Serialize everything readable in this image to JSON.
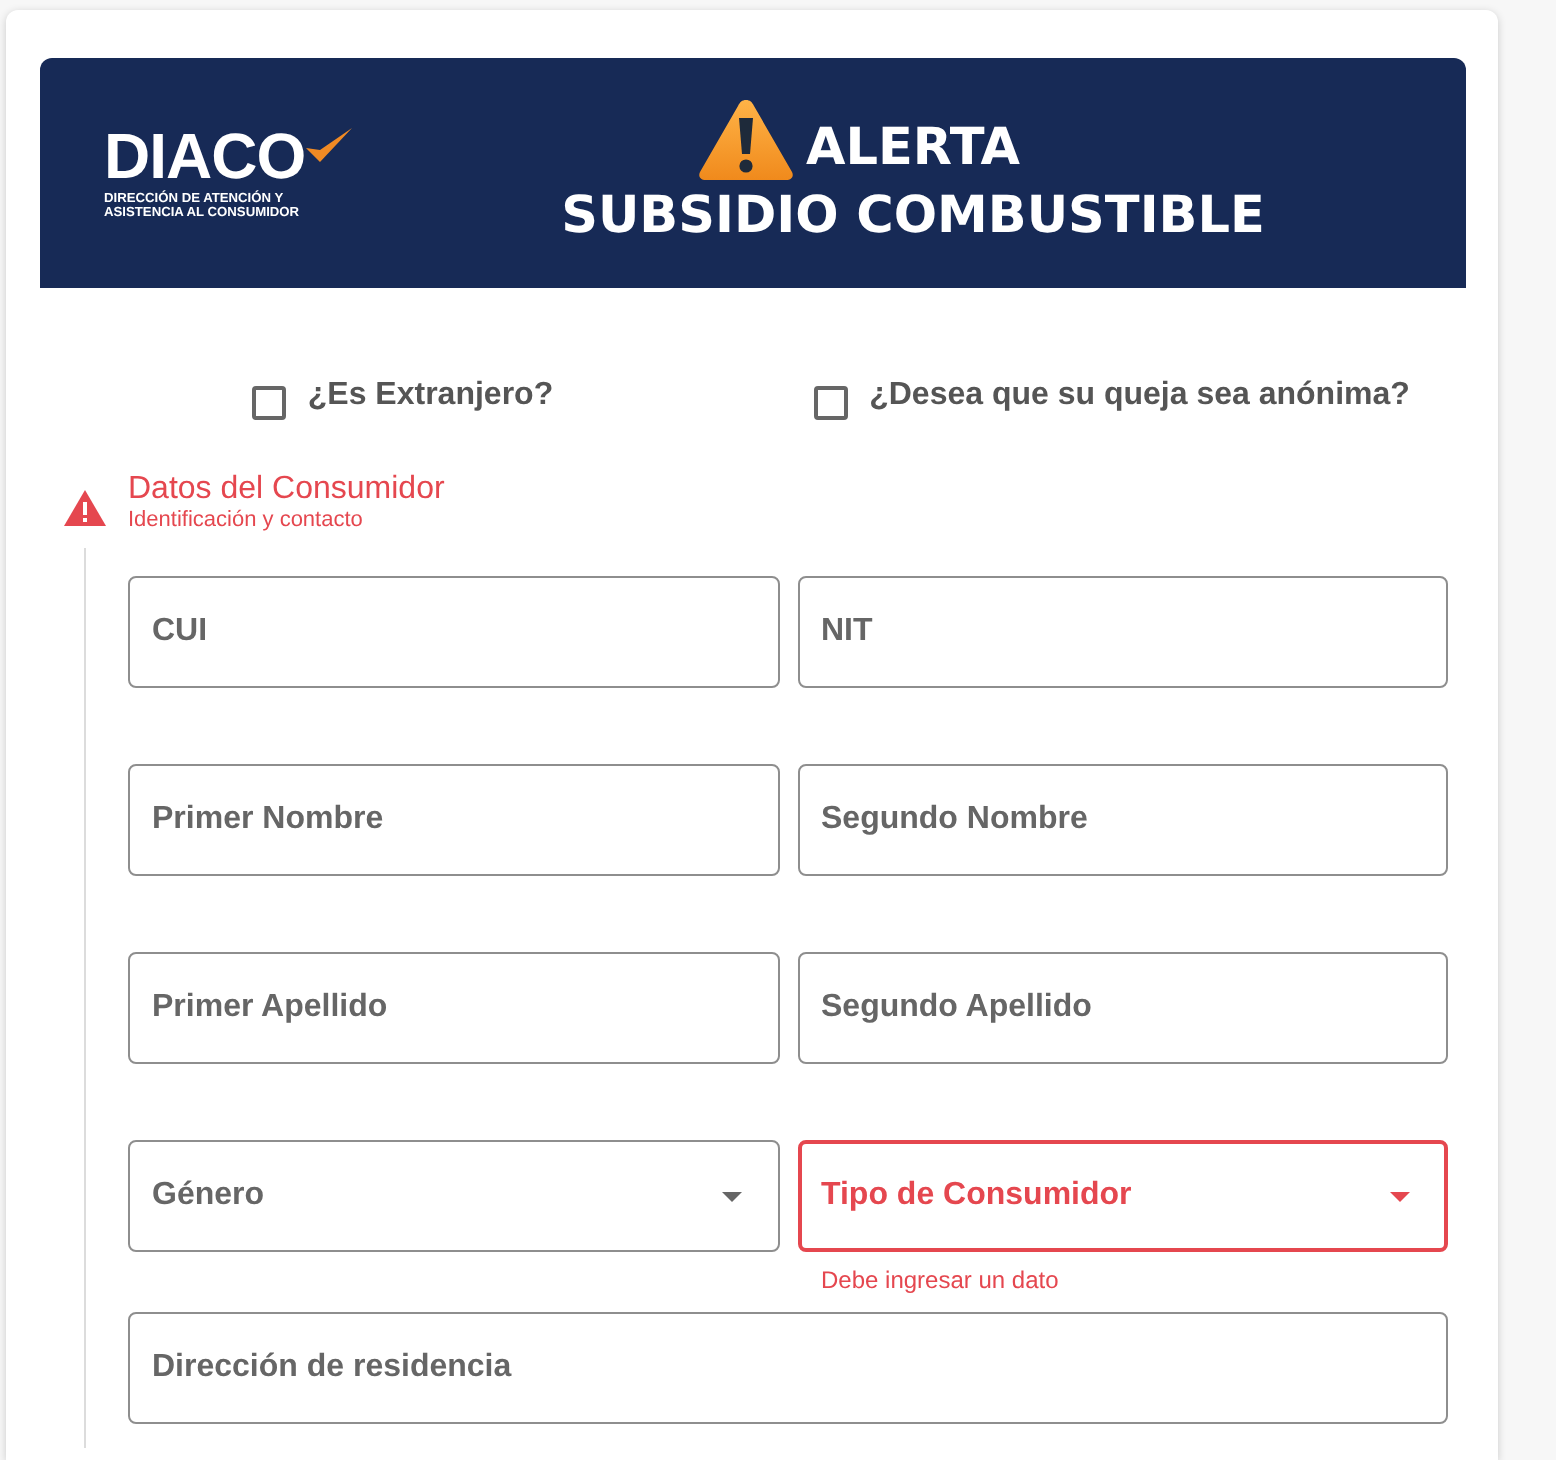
{
  "banner": {
    "logo": {
      "wordmark": "DIACO",
      "tagline_lines": [
        "DIRECCIÓN DE ATENCIÓN Y",
        "ASISTENCIA AL CONSUMIDOR"
      ]
    },
    "title": {
      "alert": "ALERTA",
      "subject": "SUBSIDIO COMBUSTIBLE"
    }
  },
  "options": [
    {
      "label": "¿Es Extranjero?",
      "checked": false
    },
    {
      "label": "¿Desea que su queja sea anónima?",
      "checked": false
    }
  ],
  "section": {
    "title": "Datos del Consumidor",
    "subtitle": "Identificación y contacto",
    "error": true
  },
  "field_rows": [
    [
      {
        "label": "CUI",
        "kind": "text",
        "error": false
      },
      {
        "label": "NIT",
        "kind": "text",
        "error": false
      }
    ],
    [
      {
        "label": "Primer Nombre",
        "kind": "text",
        "error": false
      },
      {
        "label": "Segundo Nombre",
        "kind": "text",
        "error": false
      }
    ],
    [
      {
        "label": "Primer Apellido",
        "kind": "text",
        "error": false
      },
      {
        "label": "Segundo Apellido",
        "kind": "text",
        "error": false
      }
    ],
    [
      {
        "label": "Género",
        "kind": "select",
        "error": false
      },
      {
        "label": "Tipo de Consumidor",
        "kind": "select",
        "error": true,
        "error_text": "Debe ingresar un dato"
      }
    ],
    [
      {
        "label": "Dirección de residencia",
        "kind": "text",
        "error": false
      }
    ]
  ]
}
